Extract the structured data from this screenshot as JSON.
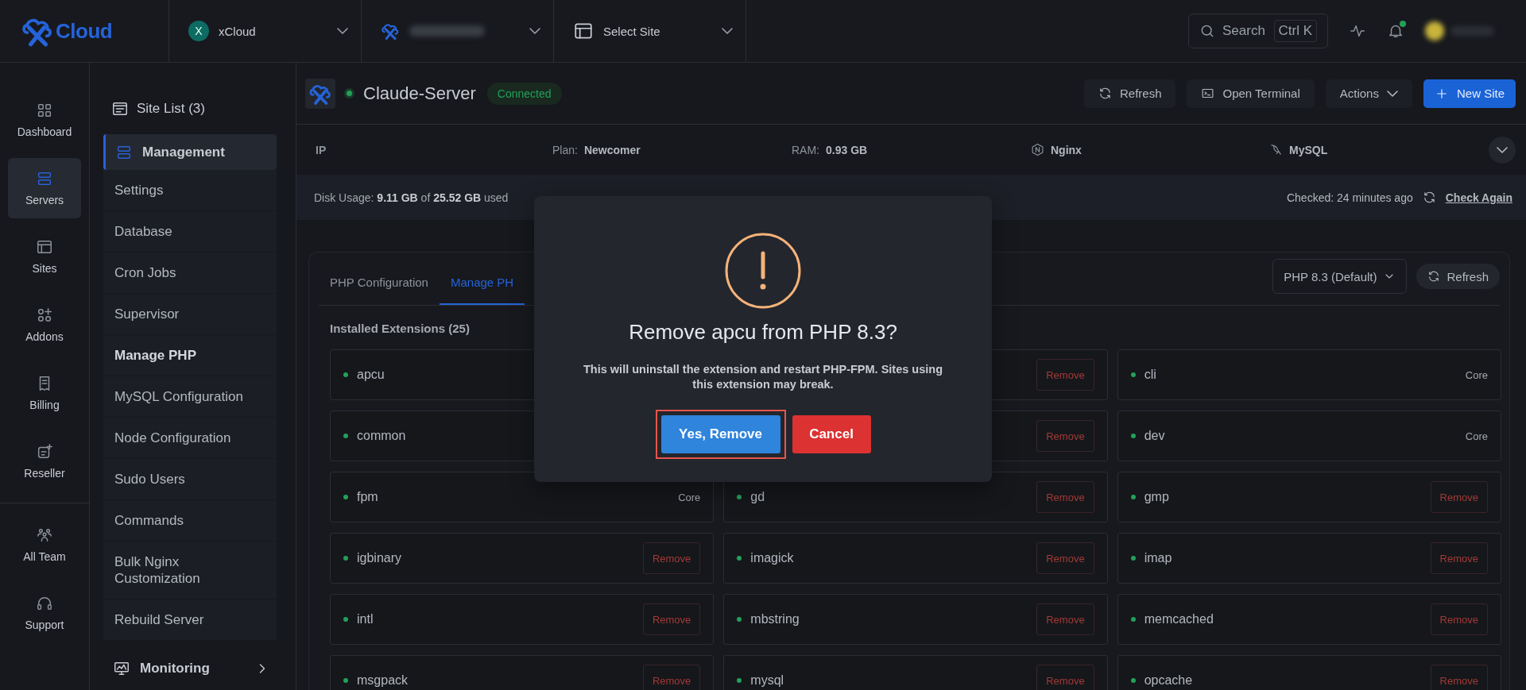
{
  "topbar": {
    "logo_text": "Cloud",
    "breadcrumbs": [
      {
        "kind": "team",
        "avatar": "X",
        "label": "xCloud"
      },
      {
        "kind": "server"
      },
      {
        "kind": "site",
        "label": "Select Site"
      }
    ],
    "search": {
      "placeholder": "Search",
      "shortcut": "Ctrl K"
    },
    "notifications": {
      "unread": true
    }
  },
  "rail": {
    "items": [
      {
        "label": "Dashboard",
        "selected": false
      },
      {
        "label": "Servers",
        "selected": true
      },
      {
        "label": "Sites",
        "selected": false
      },
      {
        "label": "Addons",
        "selected": false
      },
      {
        "label": "Billing",
        "selected": false
      },
      {
        "label": "Reseller",
        "selected": false
      }
    ],
    "bottom_items": [
      {
        "label": "All Team",
        "selected": false
      },
      {
        "label": "Support",
        "selected": false
      }
    ]
  },
  "subnav": {
    "site_list": "Site List (3)",
    "sections": [
      {
        "label": "Management",
        "expanded": true,
        "items": [
          {
            "label": "Settings",
            "selected": false
          },
          {
            "label": "Database",
            "selected": false
          },
          {
            "label": "Cron Jobs",
            "selected": false
          },
          {
            "label": "Supervisor",
            "selected": false
          },
          {
            "label": "Manage PHP",
            "selected": true
          },
          {
            "label": "MySQL Configuration",
            "selected": false
          },
          {
            "label": "Node Configuration",
            "selected": false
          },
          {
            "label": "Sudo Users",
            "selected": false
          },
          {
            "label": "Commands",
            "selected": false
          },
          {
            "label": "Bulk Nginx Customization",
            "selected": false
          },
          {
            "label": "Rebuild Server",
            "selected": false
          }
        ]
      },
      {
        "label": "Monitoring",
        "expanded": false
      }
    ]
  },
  "server": {
    "name": "Claude-Server",
    "online": true,
    "status": "Connected",
    "buttons": [
      {
        "kind": "refresh",
        "label": "Refresh"
      },
      {
        "kind": "terminal",
        "label": "Open Terminal"
      },
      {
        "kind": "dropdown",
        "label": "Actions"
      },
      {
        "kind": "primary",
        "label": "New Site"
      }
    ]
  },
  "info": {
    "fields": [
      {
        "kind": "label_only",
        "label": "IP"
      },
      {
        "kind": "labeled",
        "label": "Plan:",
        "value": "Newcomer"
      },
      {
        "kind": "labeled",
        "label": "RAM:",
        "value": "0.93 GB"
      },
      {
        "kind": "web_server",
        "value": "Nginx"
      },
      {
        "kind": "database",
        "value": "MySQL"
      }
    ]
  },
  "disk": {
    "usage": "Disk Usage: **9.11 GB** of **25.52 GB** used",
    "checked": "Checked: 24 minutes ago",
    "action": "Check Again"
  },
  "php": {
    "tabs": [
      {
        "label": "PHP Configuration",
        "selected": false
      },
      {
        "label": "Manage PH",
        "selected": true
      }
    ],
    "version": "PHP 8.3 (Default)",
    "refresh": "Refresh",
    "heading": "Installed Extensions (25)",
    "extensions": [
      {
        "name": "apcu"
      },
      {
        "action": {
          "kind": "remove",
          "label": "Remove"
        }
      },
      {
        "name": "cli",
        "action": {
          "kind": "core",
          "label": "Core"
        }
      },
      {
        "name": "common"
      },
      {
        "action": {
          "kind": "remove",
          "label": "Remove"
        }
      },
      {
        "name": "dev",
        "action": {
          "kind": "core",
          "label": "Core"
        }
      },
      {
        "name": "fpm",
        "action": {
          "kind": "core",
          "label": "Core"
        }
      },
      {
        "name": "gd",
        "action": {
          "kind": "remove",
          "label": "Remove"
        }
      },
      {
        "name": "gmp",
        "action": {
          "kind": "remove",
          "label": "Remove"
        }
      },
      {
        "name": "igbinary",
        "action": {
          "kind": "remove",
          "label": "Remove"
        }
      },
      {
        "name": "imagick",
        "action": {
          "kind": "remove",
          "label": "Remove"
        }
      },
      {
        "name": "imap",
        "action": {
          "kind": "remove",
          "label": "Remove"
        }
      },
      {
        "name": "intl",
        "action": {
          "kind": "remove",
          "label": "Remove"
        }
      },
      {
        "name": "mbstring",
        "action": {
          "kind": "remove",
          "label": "Remove"
        }
      },
      {
        "name": "memcached",
        "action": {
          "kind": "remove",
          "label": "Remove"
        }
      },
      {
        "name": "msgpack",
        "action": {
          "kind": "remove",
          "label": "Remove"
        }
      },
      {
        "name": "mysql",
        "action": {
          "kind": "remove",
          "label": "Remove"
        }
      },
      {
        "name": "opcache",
        "action": {
          "kind": "remove",
          "label": "Remove"
        }
      }
    ]
  },
  "modal": {
    "title": "Remove apcu from PHP 8.3?",
    "message": "This will uninstall the extension and restart PHP-FPM. Sites using this extension may break.",
    "confirm": {
      "label": "Yes, Remove",
      "highlighted": true
    },
    "cancel": "Cancel"
  }
}
